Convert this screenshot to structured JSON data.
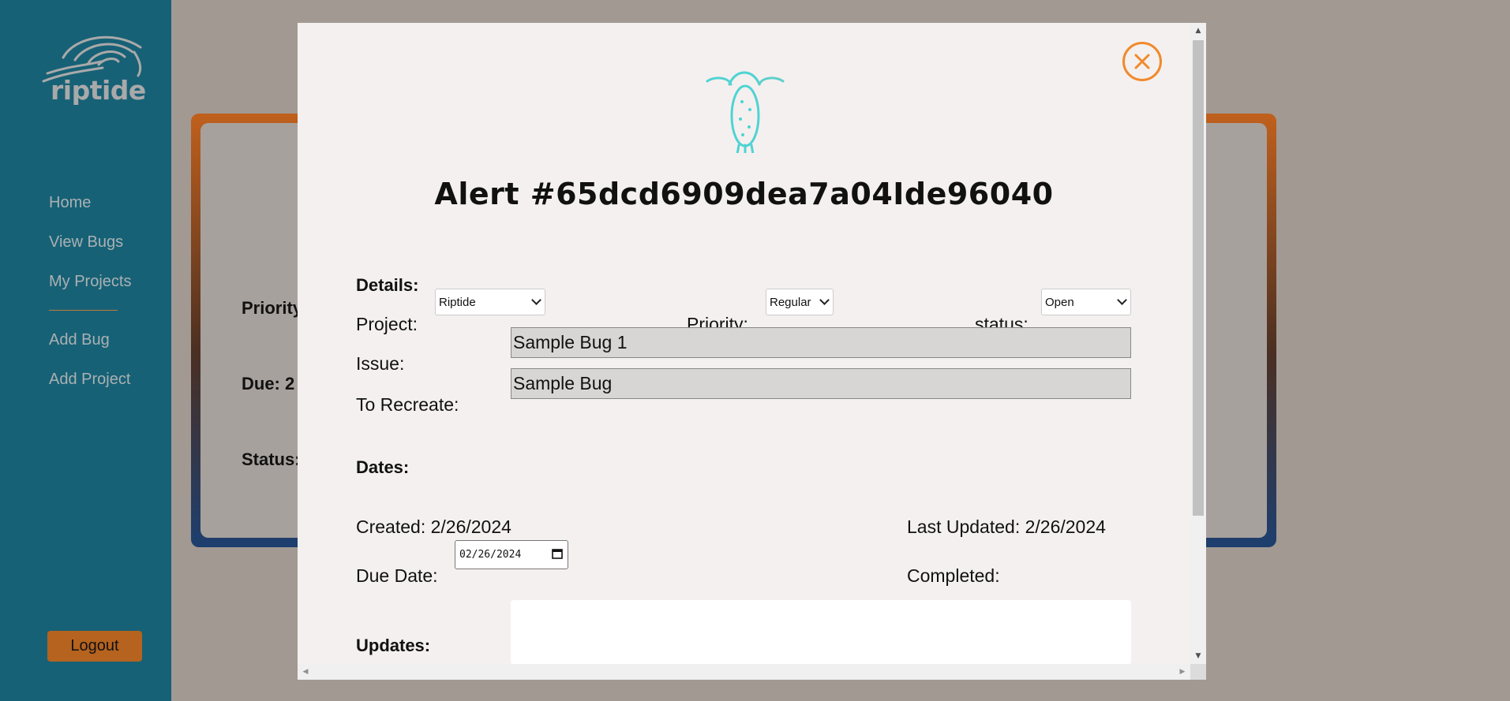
{
  "sidebar": {
    "logo_text": "riptide",
    "nav": [
      {
        "label": "Home"
      },
      {
        "label": "View Bugs"
      },
      {
        "label": "My Projects"
      },
      {
        "label": "Add Bug"
      },
      {
        "label": "Add Project"
      }
    ],
    "logout_label": "Logout"
  },
  "background_card": {
    "priority_label": "Priority",
    "due_label": "Due:  2",
    "status_label": "Status:"
  },
  "modal": {
    "title": "Alert #65dcd6909dea7a04Ide96040",
    "close_icon": "close-circle-icon",
    "bug_icon": "bug-icon",
    "details_label": "Details:",
    "project_label": "Project:",
    "project_value": "Riptide",
    "priority_label": "Priority:",
    "priority_value": "Regular",
    "status_label": "status:",
    "status_value": "Open",
    "issue_label": "Issue:",
    "issue_value": "Sample Bug 1",
    "recreate_label": "To Recreate:",
    "recreate_value": "Sample Bug",
    "dates_label": "Dates:",
    "created_label": "Created:",
    "created_value": "2/26/2024",
    "updated_label": "Last Updated:",
    "updated_value": "2/26/2024",
    "due_label": "Due Date:",
    "due_value": "02/26/2024",
    "completed_label": "Completed:",
    "updates_label": "Updates:"
  },
  "colors": {
    "sidebar": "#176176",
    "accent_orange": "#f08a2c",
    "logout": "#b5631f",
    "bug_teal": "#4fd3d3"
  }
}
